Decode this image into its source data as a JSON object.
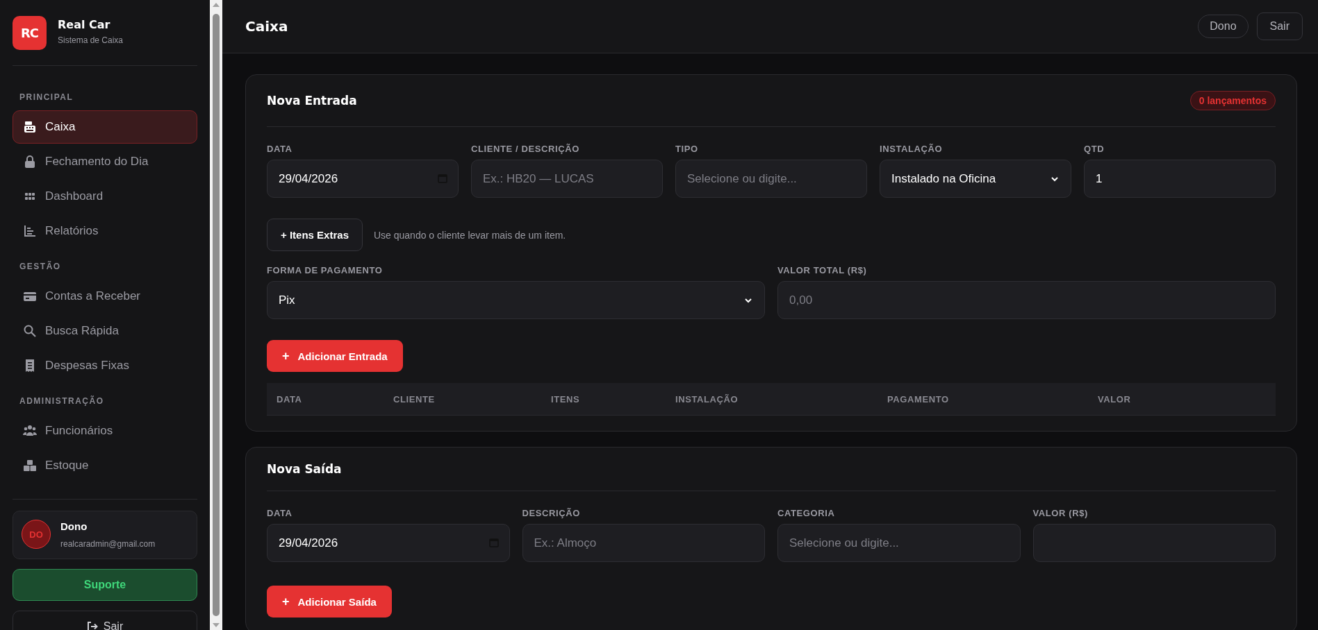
{
  "brand": {
    "logo": "RC",
    "name": "Real Car",
    "subtitle": "Sistema de Caixa"
  },
  "sidebar": {
    "sections": [
      {
        "title": "PRINCIPAL",
        "items": [
          {
            "label": "Caixa",
            "selected": true
          },
          {
            "label": "Fechamento do Dia",
            "selected": false
          },
          {
            "label": "Dashboard",
            "selected": false
          },
          {
            "label": "Relatórios",
            "selected": false
          }
        ]
      },
      {
        "title": "GESTÃO",
        "items": [
          {
            "label": "Contas a Receber",
            "selected": false
          },
          {
            "label": "Busca Rápida",
            "selected": false
          },
          {
            "label": "Despesas Fixas",
            "selected": false
          }
        ]
      },
      {
        "title": "ADMINISTRAÇÃO",
        "items": [
          {
            "label": "Funcionários",
            "selected": false
          },
          {
            "label": "Estoque",
            "selected": false
          }
        ]
      }
    ],
    "user": {
      "initials": "DO",
      "name": "Dono",
      "email": "realcaradmin@gmail.com"
    },
    "support_button": "Suporte",
    "logout_button": "Sair"
  },
  "header": {
    "title": "Caixa",
    "buttons": [
      {
        "label": "Dono",
        "kind": "pill"
      },
      {
        "label": "Sair",
        "kind": "outline"
      }
    ]
  },
  "entrada": {
    "title": "Nova Entrada",
    "badge": "0 lançamentos",
    "fields": [
      {
        "label": "DATA",
        "kind": "date",
        "value": "29/04/2026"
      },
      {
        "label": "CLIENTE / DESCRIÇÃO",
        "kind": "text",
        "placeholder": "Ex.: HB20 — LUCAS"
      },
      {
        "label": "TIPO",
        "kind": "text",
        "placeholder": "Selecione ou digite..."
      },
      {
        "label": "INSTALAÇÃO",
        "kind": "select",
        "value": "Instalado na Oficina"
      },
      {
        "label": "QTD",
        "kind": "text",
        "value": "1"
      }
    ],
    "extras_button": "+ Itens Extras",
    "extras_hint": "Use quando o cliente levar mais de um item.",
    "payment_fields": [
      {
        "label": "FORMA DE PAGAMENTO",
        "kind": "select",
        "value": "Pix"
      },
      {
        "label": "VALOR TOTAL (R$)",
        "kind": "text",
        "placeholder": "0,00"
      }
    ],
    "add_button": {
      "icon": "+",
      "label": "Adicionar Entrada"
    },
    "table": {
      "columns": [
        "DATA",
        "CLIENTE",
        "ITENS",
        "INSTALAÇÃO",
        "PAGAMENTO",
        "VALOR"
      ]
    }
  },
  "saida": {
    "title": "Nova Saída",
    "fields": [
      {
        "label": "DATA",
        "kind": "date",
        "value": "29/04/2026"
      },
      {
        "label": "DESCRIÇÃO",
        "kind": "text",
        "placeholder": "Ex.: Almoço"
      },
      {
        "label": "CATEGORIA",
        "kind": "text",
        "placeholder": "Selecione ou digite..."
      },
      {
        "label": "VALOR (R$)",
        "kind": "text"
      }
    ],
    "add_button": {
      "icon": "+",
      "label": "Adicionar Saída"
    }
  }
}
